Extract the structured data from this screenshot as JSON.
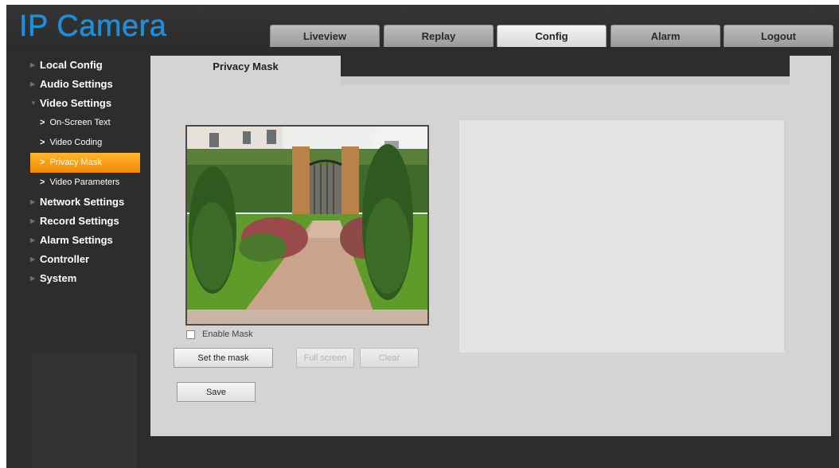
{
  "app": {
    "title": "IP Camera"
  },
  "nav": {
    "tabs": [
      {
        "label": "Liveview"
      },
      {
        "label": "Replay"
      },
      {
        "label": "Config",
        "active": true
      },
      {
        "label": "Alarm"
      },
      {
        "label": "Logout"
      }
    ]
  },
  "sidebar": {
    "items": [
      {
        "label": "Local Config"
      },
      {
        "label": "Audio Settings"
      },
      {
        "label": "Video Settings",
        "expanded": true,
        "children": [
          {
            "label": "On-Screen Text"
          },
          {
            "label": "Video Coding"
          },
          {
            "label": "Privacy Mask",
            "active": true
          },
          {
            "label": "Video Parameters"
          }
        ]
      },
      {
        "label": "Network Settings"
      },
      {
        "label": "Record Settings"
      },
      {
        "label": "Alarm Settings"
      },
      {
        "label": "Controller"
      },
      {
        "label": "System"
      }
    ]
  },
  "content": {
    "tab_label": "Privacy Mask",
    "enable_mask_label": "Enable Mask",
    "enable_mask_checked": false,
    "buttons": {
      "set_mask": "Set the mask",
      "full_screen": "Full screen",
      "clear": "Clear",
      "save": "Save"
    }
  },
  "colors": {
    "logo": "#1d8fe0",
    "active_menu": "#f08a00",
    "background": "#2d2d2d",
    "content_bg": "#d6d4d3"
  },
  "icons": {
    "menu_arrow": "triangle-right-icon",
    "menu_arrow_expanded": "triangle-down-icon",
    "sub_chevron": "chevron-right-icon"
  }
}
